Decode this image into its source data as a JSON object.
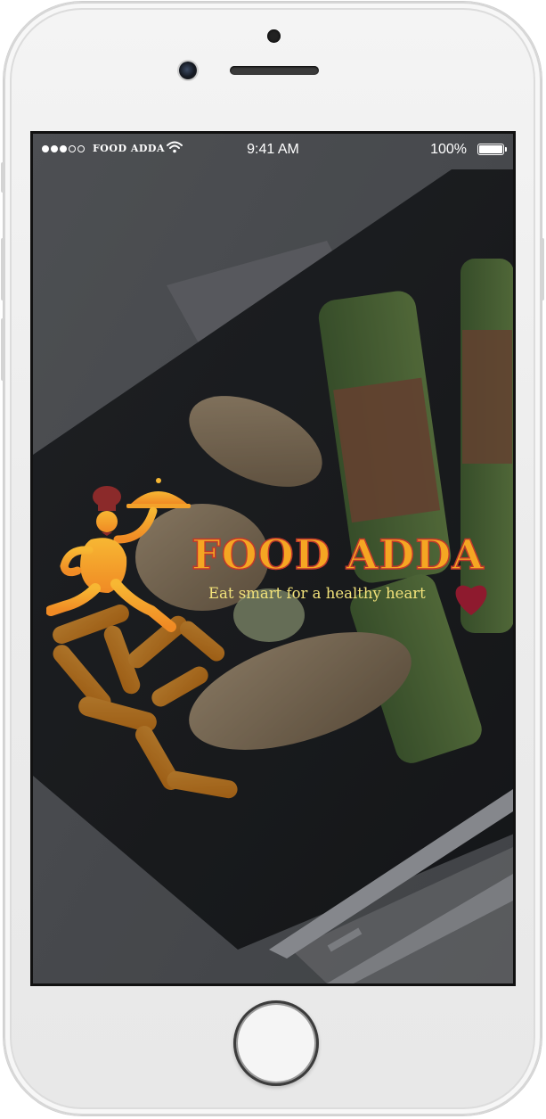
{
  "status_bar": {
    "carrier": "FOOD ADDA",
    "time": "9:41 AM",
    "battery": "100%",
    "signal_bars_full": 3,
    "signal_bars_total": 5
  },
  "splash": {
    "brand": "FOOD ADDA",
    "tagline": "Eat smart for a healthy heart"
  },
  "icons": {
    "chef": "running-chef-icon",
    "heart": "heart-icon",
    "wifi": "wifi-icon",
    "battery": "battery-icon"
  },
  "colors": {
    "brand_orange": "#f5a623",
    "brand_red": "#c0392b",
    "tagline_yellow": "#f2e27a",
    "heart": "#8e1a2e",
    "chef_hat": "#8b2a2a"
  }
}
